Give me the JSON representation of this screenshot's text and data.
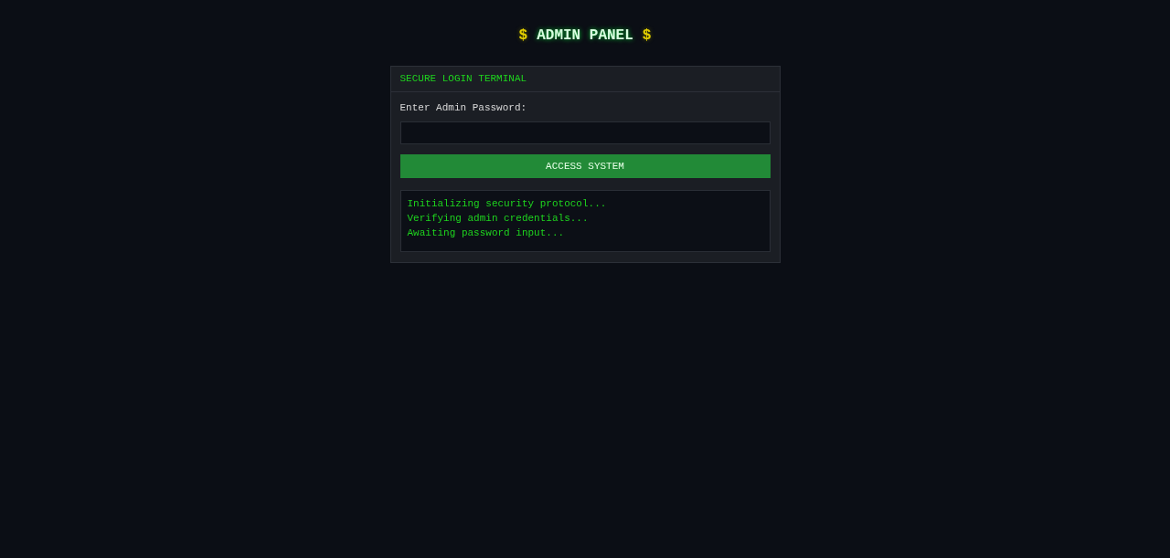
{
  "title": {
    "prefix": "$",
    "text": "ADMIN PANEL",
    "suffix": "$"
  },
  "panel": {
    "header": "SECURE LOGIN TERMINAL",
    "password_label": "Enter Admin Password:",
    "button": "ACCESS SYSTEM",
    "log": [
      "Initializing security protocol...",
      "Verifying admin credentials...",
      "Awaiting password input..."
    ]
  }
}
